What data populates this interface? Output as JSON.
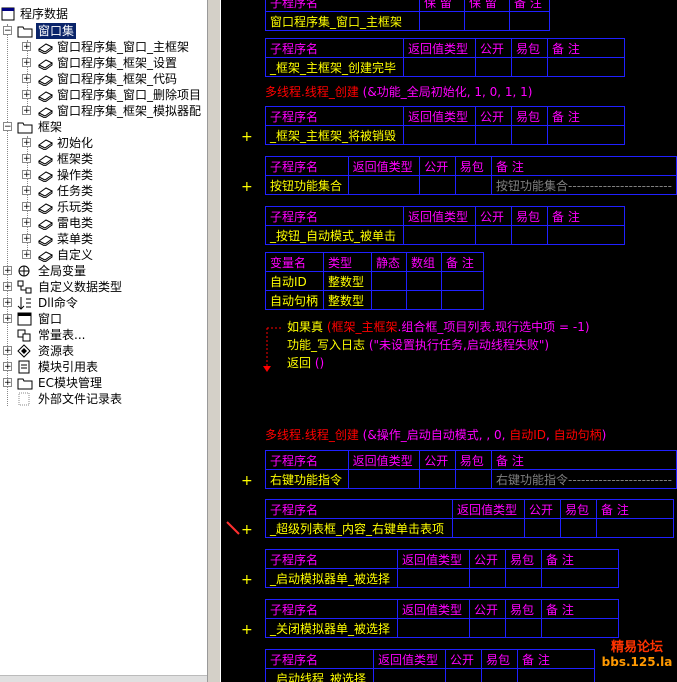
{
  "tree": {
    "root": "程序数据",
    "window_set": "窗口集",
    "window_children": [
      "窗口程序集_窗口_主框架",
      "窗口程序集_框架_设置",
      "窗口程序集_框架_代码",
      "窗口程序集_窗口_删除项目",
      "窗口程序集_框架_模拟器配"
    ],
    "frame": "框架",
    "frame_children": [
      "初始化",
      "框架类",
      "操作类",
      "任务类",
      "乐玩类",
      "雷电类",
      "菜单类",
      "自定义"
    ],
    "others": [
      "全局变量",
      "自定义数据类型",
      "Dll命令",
      "窗口",
      "常量表...",
      "资源表",
      "模块引用表",
      "EC模块管理",
      "外部文件记录表"
    ]
  },
  "headers": {
    "sub": "子程序名",
    "ret": "返回值类型",
    "pub": "公开",
    "easy": "易包",
    "note": "备 注",
    "var": "变量名",
    "type": "类型",
    "static": "静态",
    "arr": "数组"
  },
  "top_partial": {
    "name": "窗口程序集_窗口_主框架",
    "h1": "子程序名",
    "h2": "保 留",
    "h3": "保 留",
    "h4": "备 注"
  },
  "subs": {
    "s1": "_框架_主框架_创建完毕",
    "s2": "_框架_主框架_将被销毁",
    "s3": "按钮功能集合",
    "s3_note": "按钮功能集合------------------------",
    "s4": "_按钮_自动模式_被单击",
    "s5": "右键功能指令",
    "s5_note": "右键功能指令------------------------",
    "s6": "_超级列表框_内容_右键单击表项",
    "s7": "_启动模拟器单_被选择",
    "s8": "_关闭模拟器单_被选择",
    "s9": "_启动线程_被选择"
  },
  "vars": [
    {
      "name": "自动ID",
      "type": "整数型"
    },
    {
      "name": "自动句柄",
      "type": "整数型"
    }
  ],
  "code": {
    "thread1_cmd": "多线程.线程_创建",
    "thread1_args": "(&功能_全局初始化, 1, 0, 1, 1)",
    "if_kw": "如果真",
    "if_paren_open": "(",
    "if_obj": "框架_主框架",
    "if_rest": ".组合框_项目列表.现行选中项 = -1)",
    "log_cmd": "功能_写入日志",
    "log_args": "(\"未设置执行任务,启动线程失败\")",
    "ret_cmd": "返回",
    "ret_args": "()",
    "thread2_cmd": "多线程.线程_创建",
    "thread2_args_a": "(&操作_启动自动模式, , 0, ",
    "thread2_arg_b": "自动ID",
    "thread2_sep": ", ",
    "thread2_arg_c": "自动句柄",
    "thread2_close": ")",
    "plus": "+"
  },
  "watermark": {
    "line1": "精易论坛",
    "line2": "bbs.125.la"
  },
  "colors": {
    "editor_bg": "#000000",
    "table_border": "#2020ff",
    "header": "#ff00ff",
    "value": "#ffff00",
    "keyword": "#ff0000"
  }
}
